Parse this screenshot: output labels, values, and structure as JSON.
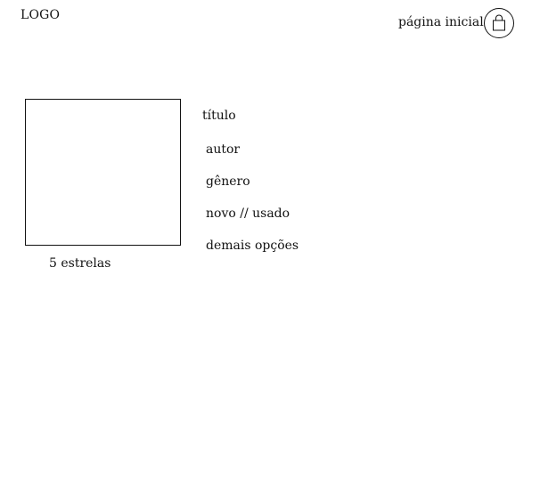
{
  "header": {
    "logo": "LOGO",
    "home_link": "página inicial",
    "cart_icon": "shopping-bag-icon"
  },
  "product": {
    "image_icon": "book-cover-placeholder",
    "rating": "5 estrelas",
    "title": "título",
    "author": "autor",
    "genre": "gênero",
    "condition": "novo // usado",
    "more_options": "demais opções"
  }
}
